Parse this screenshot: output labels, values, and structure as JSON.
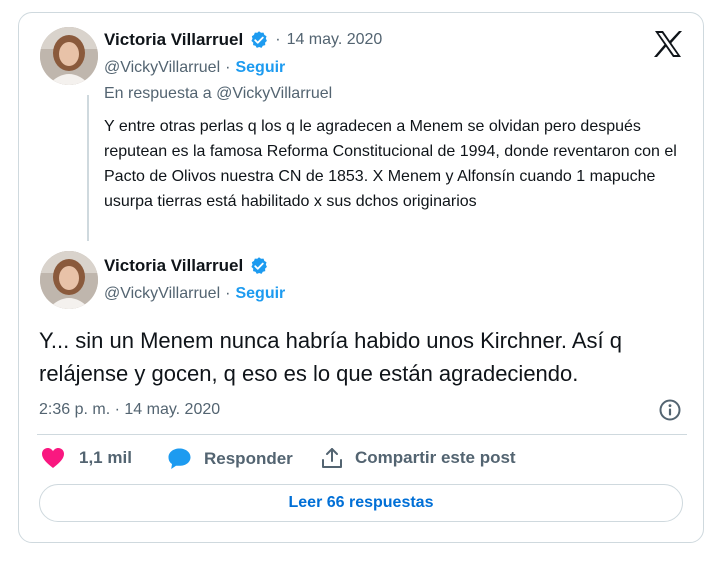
{
  "colors": {
    "accent": "#1d9bf0",
    "text": "#0f1419",
    "muted": "#536471",
    "like": "#f91880",
    "border": "#cfd9de"
  },
  "parent_tweet": {
    "author_name": "Victoria Villarruel",
    "separator": "·",
    "date": "14 may. 2020",
    "handle": "@VickyVillarruel",
    "follow_separator": "·",
    "follow_label": "Seguir",
    "reply_to": "En respuesta a @VickyVillarruel",
    "text": "Y entre otras perlas q los q le agradecen a Menem se olvidan pero después reputean es la famosa Reforma Constitucional de 1994, donde reventaron con el Pacto de Olivos nuestra CN de 1853. X Menem y Alfonsín cuando 1 mapuche usurpa tierras está habilitado x sus dchos originarios"
  },
  "main_tweet": {
    "author_name": "Victoria Villarruel",
    "handle": "@VickyVillarruel",
    "follow_separator": "·",
    "follow_label": "Seguir",
    "text": "Y... sin un Menem nunca habría habido unos Kirchner. Así q relájense y gocen, q eso es lo que están agradeciendo.",
    "timestamp": "2:36 p. m. · 14 may. 2020"
  },
  "actions": {
    "likes": "1,1 mil",
    "reply_label": "Responder",
    "share_label": "Compartir este post"
  },
  "read_replies_label": "Leer 66 respuestas",
  "icons": [
    "x-logo-icon",
    "verified-icon",
    "heart-icon",
    "reply-bubble-icon",
    "share-icon",
    "info-icon"
  ]
}
